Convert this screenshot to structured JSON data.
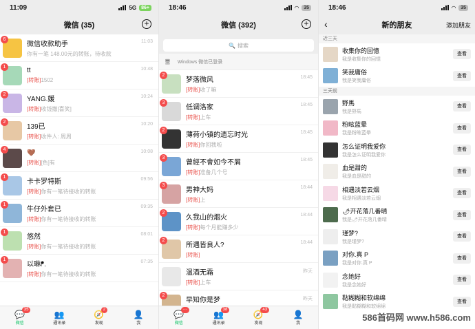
{
  "p1": {
    "time": "11:09",
    "network": "5G",
    "battery": "86+",
    "title": "微信 (35)",
    "chats": [
      {
        "name": "微信收款助手",
        "preview": "你有一笔 148.00元的转账，待收款",
        "tag": "",
        "time": "11:03",
        "badge": "6",
        "color": "#f6c443"
      },
      {
        "name": "tt",
        "preview": "1502",
        "tag": "[转账]",
        "time": "10:48",
        "badge": "1",
        "color": "#a6d9b8"
      },
      {
        "name": "YANG.媛",
        "preview": "收钱撒[喜笑]",
        "tag": "[转账]",
        "time": "10:24",
        "badge": "2",
        "color": "#c9b6e6"
      },
      {
        "name": "139已",
        "preview": "收件人: 周周",
        "tag": "[转账]",
        "time": "10:20",
        "badge": "2",
        "color": "#e7c8a5"
      },
      {
        "name": "🤎",
        "preview": "[色]有",
        "tag": "[转账]",
        "time": "10:08",
        "badge": "4",
        "color": "#5c4a4a"
      },
      {
        "name": "卡卡罗特斯",
        "preview": "你有一笔待接收的转账",
        "tag": "[转账]",
        "time": "09:56",
        "badge": "1",
        "color": "#a9c7e6"
      },
      {
        "name": "牛仔外套已",
        "preview": "你有一笔待接收的转账",
        "tag": "[转账]",
        "time": "09:35",
        "badge": "1",
        "color": "#8fb6d9"
      },
      {
        "name": "悠然",
        "preview": "你有一笔待接收的转账",
        "tag": "[转账]",
        "time": "08:01",
        "badge": "1",
        "color": "#bde0b0"
      },
      {
        "name": "以琳ᖰ.",
        "preview": "你有一笔待接收的转账",
        "tag": "[转账]",
        "time": "07:35",
        "badge": "1",
        "color": "#e3b2b2"
      }
    ],
    "tabs": [
      {
        "label": "微信",
        "icon": "💬",
        "badge": "35",
        "active": true
      },
      {
        "label": "通讯录",
        "icon": "👥",
        "badge": "",
        "active": false
      },
      {
        "label": "发现",
        "icon": "🧭",
        "badge": "2",
        "active": false
      },
      {
        "label": "我",
        "icon": "👤",
        "badge": "",
        "active": false
      }
    ]
  },
  "p2": {
    "time": "18:46",
    "battery": "35",
    "title": "微信 (392)",
    "search": "搜索",
    "windows_login": "Windows 微信已登录",
    "chats": [
      {
        "name": "梦落微风",
        "preview": "收了嘛",
        "tag": "[转账]",
        "time": "18:45",
        "badge": "2",
        "color": "#c8e0c0"
      },
      {
        "name": "低调洛家",
        "preview": "上车",
        "tag": "[转账]",
        "time": "18:45",
        "badge": "3",
        "color": "#d9d9d9"
      },
      {
        "name": "薄荷小镇的遗忘时光",
        "preview": "你回我啦",
        "tag": "[转账]",
        "time": "18:45",
        "badge": "2",
        "color": "#333333"
      },
      {
        "name": "曾經不會如今不屑",
        "preview": "准备几个号",
        "tag": "[转账]",
        "time": "18:45",
        "badge": "3",
        "color": "#7aa6d6"
      },
      {
        "name": "男神大妈",
        "preview": "上",
        "tag": "[转账]",
        "time": "18:44",
        "badge": "3",
        "color": "#d6a3a3"
      },
      {
        "name": "久我山的烟火",
        "preview": "每个月能赚多少",
        "tag": "[转账]",
        "time": "18:44",
        "badge": "2",
        "color": "#5d93c7"
      },
      {
        "name": "所遇皆良人?",
        "preview": "",
        "tag": "[转账]",
        "time": "18:44",
        "badge": "2",
        "color": "#e0c7a8"
      },
      {
        "name": "温酒无霜",
        "preview": "上车",
        "tag": "[转账]",
        "time": "昨天",
        "badge": "",
        "color": "#e8e8e8"
      },
      {
        "name": "早知你是梦",
        "preview": "小红书加你的",
        "tag": "",
        "time": "昨天",
        "badge": "2",
        "color": "#d3b58f"
      }
    ],
    "tabs": [
      {
        "label": "微信",
        "icon": "💬",
        "badge": "···",
        "active": true
      },
      {
        "label": "通讯录",
        "icon": "👥",
        "badge": "38",
        "active": false
      },
      {
        "label": "发现",
        "icon": "🧭",
        "badge": "43",
        "active": false
      },
      {
        "label": "我",
        "icon": "👤",
        "badge": "",
        "active": false
      }
    ]
  },
  "p3": {
    "time": "18:46",
    "battery": "35",
    "title": "新的朋友",
    "add_friend": "添加朋友",
    "section_recent": "近三天",
    "section_older": "三天前",
    "view_label": "查看",
    "recent": [
      {
        "name": "收集你的回憶",
        "preview": "我是收集你的回憶",
        "color": "#e5d7c6"
      },
      {
        "name": "笑我庸俗",
        "preview": "我是笑我庸俗",
        "color": "#7fb0d6"
      }
    ],
    "older": [
      {
        "name": "野馬",
        "preview": "我是野馬",
        "color": "#9aa4ad"
      },
      {
        "name": "粉眩蓝晕",
        "preview": "我是粉眩蓝晕",
        "color": "#f1b8c7"
      },
      {
        "name": "怎么证明我爱你",
        "preview": "我是怎么证明我爱你",
        "color": "#333333"
      },
      {
        "name": "血是甜的",
        "preview": "我是血是甜的",
        "color": "#f0ede8"
      },
      {
        "name": "相遇淡若云烟",
        "preview": "我是相遇淡若云烟",
        "color": "#f6d9e6"
      },
      {
        "name": "🌶开花落几番晴",
        "preview": "我是🌶开花落几番晴",
        "color": "#4d6b4d"
      },
      {
        "name": "瑾梦?",
        "preview": "我是瑾梦?",
        "color": "#eeeeee"
      },
      {
        "name": "对你.真 P",
        "preview": "我是对你.真 P",
        "color": "#7aa0c2"
      },
      {
        "name": "念她好",
        "preview": "我是念她好",
        "color": "#f2f2f2"
      },
      {
        "name": "黏糊糊和软绵绵",
        "preview": "我是黏糊糊和软绵绵",
        "color": "#8ec7a0"
      }
    ],
    "watermark": "586首码网 www.h586.com"
  }
}
